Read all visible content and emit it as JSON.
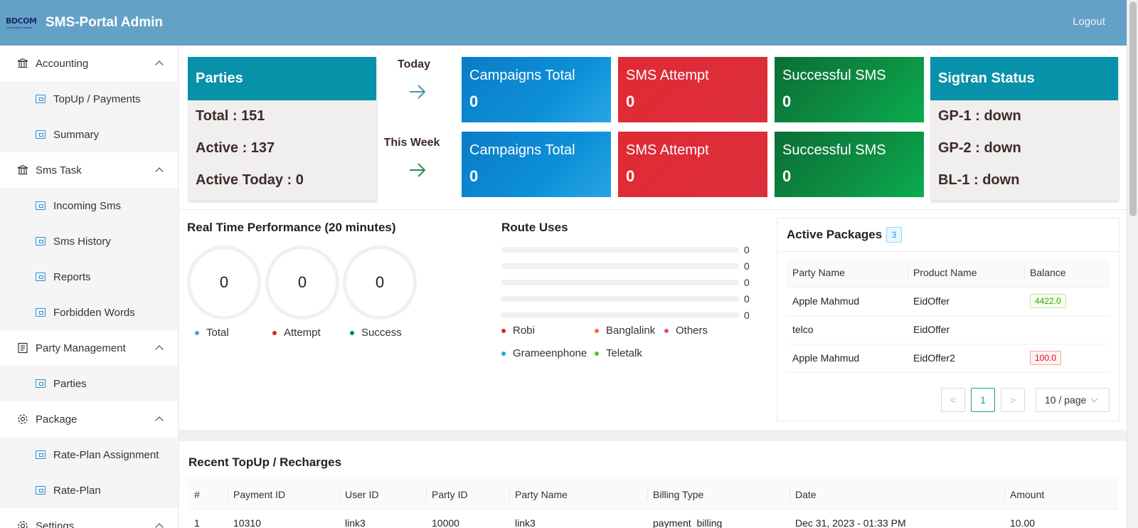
{
  "header": {
    "logo_text": "BDCOM",
    "logo_sub": "Connecting Progress",
    "title": "SMS-Portal Admin",
    "logout_label": "Logout"
  },
  "sidebar": {
    "groups": [
      {
        "label": "Accounting",
        "icon": "bank-icon",
        "items": [
          {
            "label": "TopUp / Payments"
          },
          {
            "label": "Summary"
          }
        ]
      },
      {
        "label": "Sms Task",
        "icon": "bank-icon",
        "items": [
          {
            "label": "Incoming Sms"
          },
          {
            "label": "Sms History"
          },
          {
            "label": "Reports"
          },
          {
            "label": "Forbidden Words"
          }
        ]
      },
      {
        "label": "Party Management",
        "icon": "profile-icon",
        "items": [
          {
            "label": "Parties"
          }
        ]
      },
      {
        "label": "Package",
        "icon": "gear-icon",
        "items": [
          {
            "label": "Rate-Plan Assignment"
          },
          {
            "label": "Rate-Plan"
          }
        ]
      },
      {
        "label": "Settings",
        "icon": "gear-icon",
        "items": []
      }
    ]
  },
  "parties": {
    "title": "Parties",
    "total": "Total : 151",
    "active": "Active : 137",
    "active_today": "Active Today : 0"
  },
  "periods": {
    "today": "Today",
    "week": "This Week"
  },
  "stats": {
    "today": {
      "campaigns_label": "Campaigns Total",
      "campaigns_value": "0",
      "attempt_label": "SMS Attempt",
      "attempt_value": "0",
      "success_label": "Successful SMS",
      "success_value": "0"
    },
    "week": {
      "campaigns_label": "Campaigns Total",
      "campaigns_value": "0",
      "attempt_label": "SMS Attempt",
      "attempt_value": "0",
      "success_label": "Successful SMS",
      "success_value": "0"
    }
  },
  "sigtran": {
    "title": "Sigtran Status",
    "lines": [
      "GP-1 : down",
      "GP-2 : down",
      "BL-1 : down"
    ]
  },
  "performance": {
    "title": "Real Time Performance (20 minutes)",
    "gauges": [
      {
        "value": "0",
        "label": "Total",
        "color": "#5b9bd5"
      },
      {
        "value": "0",
        "label": "Attempt",
        "color": "#e0242f"
      },
      {
        "value": "0",
        "label": "Success",
        "color": "#0b8a3a"
      }
    ]
  },
  "routes": {
    "title": "Route Uses",
    "values": [
      "0",
      "0",
      "0",
      "0",
      "0"
    ],
    "legend": [
      {
        "label": "Robi",
        "color": "#e0242f"
      },
      {
        "label": "Banglalink",
        "color": "#f26b3a"
      },
      {
        "label": "Others",
        "color": "#e04a8a"
      },
      {
        "label": "Grameenphone",
        "color": "#1fa3e0"
      },
      {
        "label": "Teletalk",
        "color": "#52c41a"
      }
    ]
  },
  "packages": {
    "title": "Active Packages",
    "count": "3",
    "columns": [
      "Party Name",
      "Product Name",
      "Balance"
    ],
    "rows": [
      [
        "Apple Mahmud",
        "EidOffer",
        "4422.0"
      ],
      [
        "telco",
        "EidOffer",
        ""
      ],
      [
        "Apple Mahmud",
        "EidOffer2",
        "100.0"
      ]
    ],
    "pagination": {
      "prev": "<",
      "current": "1",
      "next": ">",
      "page_size": "10 / page"
    }
  },
  "recent": {
    "title": "Recent TopUp / Recharges",
    "columns": [
      "#",
      "Payment ID",
      "User ID",
      "Party ID",
      "Party Name",
      "Billing Type",
      "Date",
      "Amount"
    ],
    "rows": [
      [
        "1",
        "10310",
        "link3",
        "10000",
        "link3",
        "payment_billing",
        "Dec 31, 2023 - 01:33 PM",
        "10.00"
      ]
    ]
  },
  "colors": {
    "header_bg": "#64a1c7",
    "card_teal": "#0792a9",
    "blue": "#0d8fd8",
    "red": "#dc2f3c",
    "green": "#0d8a41"
  }
}
